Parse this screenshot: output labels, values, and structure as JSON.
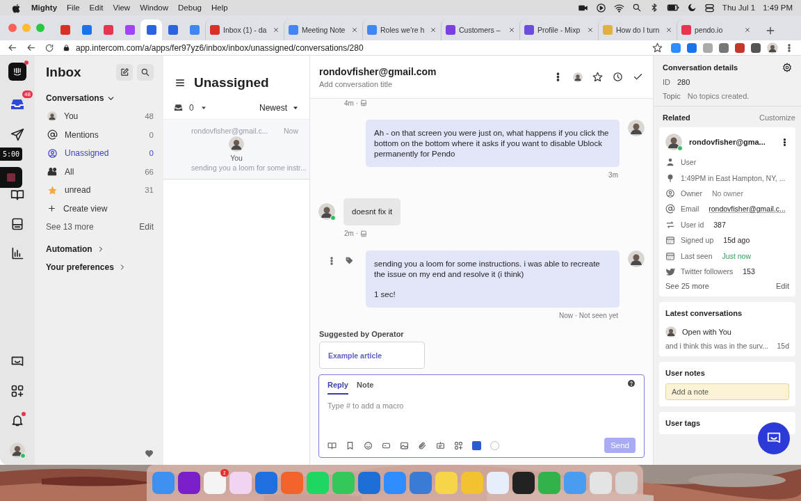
{
  "menubar": {
    "app": "Mighty",
    "menus": [
      "File",
      "Edit",
      "View",
      "Window",
      "Debug",
      "Help"
    ],
    "date": "Thu Jul 1",
    "time": "1:49 PM"
  },
  "browser": {
    "tabs": [
      {
        "pinned": true,
        "color": "#d93025",
        "selected": false
      },
      {
        "pinned": true,
        "color": "#1a73e8",
        "selected": false
      },
      {
        "pinned": true,
        "color": "#e8344e",
        "selected": false
      },
      {
        "pinned": true,
        "color": "#a142f4",
        "selected": false
      },
      {
        "pinned": true,
        "color": "#2b63e0",
        "selected": true
      },
      {
        "pinned": true,
        "color": "#2b63e0",
        "selected": false
      },
      {
        "pinned": true,
        "color": "#4285f4",
        "selected": false
      },
      {
        "pinned": false,
        "color": "#d93025",
        "title": "Inbox (1) - da",
        "selected": false
      },
      {
        "pinned": false,
        "color": "#4285f4",
        "title": "Meeting Note",
        "selected": false
      },
      {
        "pinned": false,
        "color": "#4285f4",
        "title": "Roles we're h",
        "selected": false
      },
      {
        "pinned": false,
        "color": "#7b3fe4",
        "title": "Customers –",
        "selected": false
      },
      {
        "pinned": false,
        "color": "#6c4be0",
        "title": "Profile - Mixp",
        "selected": false
      },
      {
        "pinned": false,
        "color": "#e0b040",
        "title": "How do I turn",
        "selected": false
      },
      {
        "pinned": false,
        "color": "#e8344e",
        "title": "pendo.io",
        "selected": false
      }
    ],
    "url": "app.intercom.com/a/apps/fer97yz6/inbox/inbox/unassigned/conversations/280"
  },
  "rail": {
    "badge": "48",
    "timer": "5:00"
  },
  "inbox_nav": {
    "title": "Inbox",
    "section": "Conversations",
    "items": [
      {
        "kind": "avatar",
        "label": "You",
        "count": "48",
        "selected": false
      },
      {
        "kind": "mention",
        "label": "Mentions",
        "count": "0",
        "selected": false
      },
      {
        "kind": "unassigned",
        "label": "Unassigned",
        "count": "0",
        "selected": true
      },
      {
        "kind": "all",
        "label": "All",
        "count": "66",
        "selected": false
      },
      {
        "kind": "star",
        "label": "unread",
        "count": "31",
        "selected": false
      }
    ],
    "create_view": "Create view",
    "see_more": "See 13 more",
    "edit": "Edit",
    "groups": [
      "Automation",
      "Your preferences"
    ]
  },
  "list": {
    "title": "Unassigned",
    "filter_count": "0",
    "sort": "Newest",
    "ghost": {
      "from": "rondovfisher@gmail.c...",
      "time": "Now",
      "drag_label": "You",
      "preview": "sending you a loom for some instr..."
    }
  },
  "conversation": {
    "contact": "rondovfisher@gmail.com",
    "title_placeholder": "Add conversation title",
    "items": [
      {
        "kind": "stamp",
        "time": "4m ·"
      },
      {
        "kind": "admin",
        "paragraphs": [
          "Ah - on that screen you were just on, what happens if you click the bottom on the bottom where it asks if you want to disable Ublock permanently for Pendo"
        ],
        "meta": "3m",
        "actions": false
      },
      {
        "kind": "user",
        "paragraphs": [
          "doesnt fix it"
        ],
        "online": true
      },
      {
        "kind": "stamp",
        "time": "2m ·"
      },
      {
        "kind": "admin",
        "paragraphs": [
          "sending you a loom for some instructions. i was able to recreate the issue on my end and resolve it (i think)",
          "1 sec!"
        ],
        "meta": "Now · Not seen yet",
        "actions": true
      }
    ]
  },
  "suggested": {
    "title": "Suggested by Operator",
    "articles": [
      "Example article"
    ]
  },
  "composer": {
    "tabs": [
      {
        "label": "Reply",
        "selected": true
      },
      {
        "label": "Note",
        "selected": false
      }
    ],
    "placeholder": "Type # to add a macro",
    "send": "Send",
    "send_disabled": true
  },
  "details": {
    "title": "Conversation details",
    "fields": [
      {
        "label": "ID",
        "value": "280",
        "muted": false
      },
      {
        "label": "Topic",
        "value": "No topics created.",
        "muted": true
      }
    ]
  },
  "related": {
    "title": "Related",
    "action": "Customize",
    "contact": {
      "name": "rondovfisher@gma...",
      "online": true
    },
    "attributes": [
      {
        "kind": "person",
        "label": "User"
      },
      {
        "kind": "pin",
        "label": "1:49PM in East Hampton, NY, ..."
      },
      {
        "kind": "owner",
        "label": "Owner",
        "value": "No owner",
        "muted": true
      },
      {
        "kind": "at",
        "label": "Email",
        "value": "rondovfisher@gmail.c...",
        "muted": false
      },
      {
        "kind": "swap",
        "label": "User id",
        "value": "387",
        "muted": false
      },
      {
        "kind": "calendar",
        "label": "Signed up",
        "value": "15d ago",
        "muted": false
      },
      {
        "kind": "calendar",
        "label": "Last seen",
        "value": "Just now",
        "muted": false,
        "recent": true
      },
      {
        "kind": "bird",
        "label": "Twitter followers",
        "value": "153",
        "muted": false
      }
    ],
    "see_more": "See 25 more",
    "edit": "Edit"
  },
  "latest": {
    "title": "Latest conversations",
    "items": [
      {
        "status": "Open with You",
        "preview": "and i think this was in the surv...",
        "time": "15d"
      }
    ]
  },
  "notes": {
    "title": "User notes",
    "placeholder": "Add a note"
  },
  "tags": {
    "title": "User tags"
  },
  "dock": [
    {
      "color": "#3d8ff0"
    },
    {
      "color": "#7a1fc9"
    },
    {
      "color": "#f4f4f4",
      "badge": "1"
    },
    {
      "color": "#f2d4f0"
    },
    {
      "color": "#1e6fe0"
    },
    {
      "color": "#f0642c"
    },
    {
      "color": "#1ed760"
    },
    {
      "color": "#34c759"
    },
    {
      "color": "#1b6fd6"
    },
    {
      "color": "#2d8cff"
    },
    {
      "color": "#3a7bd5"
    },
    {
      "color": "#f7d54a"
    },
    {
      "color": "#f2c230"
    },
    {
      "color": "#e6eefc"
    },
    {
      "color": "#222222"
    },
    {
      "color": "#2fb34a"
    },
    {
      "color": "#4a9cf0"
    },
    {
      "color": "#e4e4e4"
    },
    {
      "color": "#d8d8d8"
    }
  ]
}
